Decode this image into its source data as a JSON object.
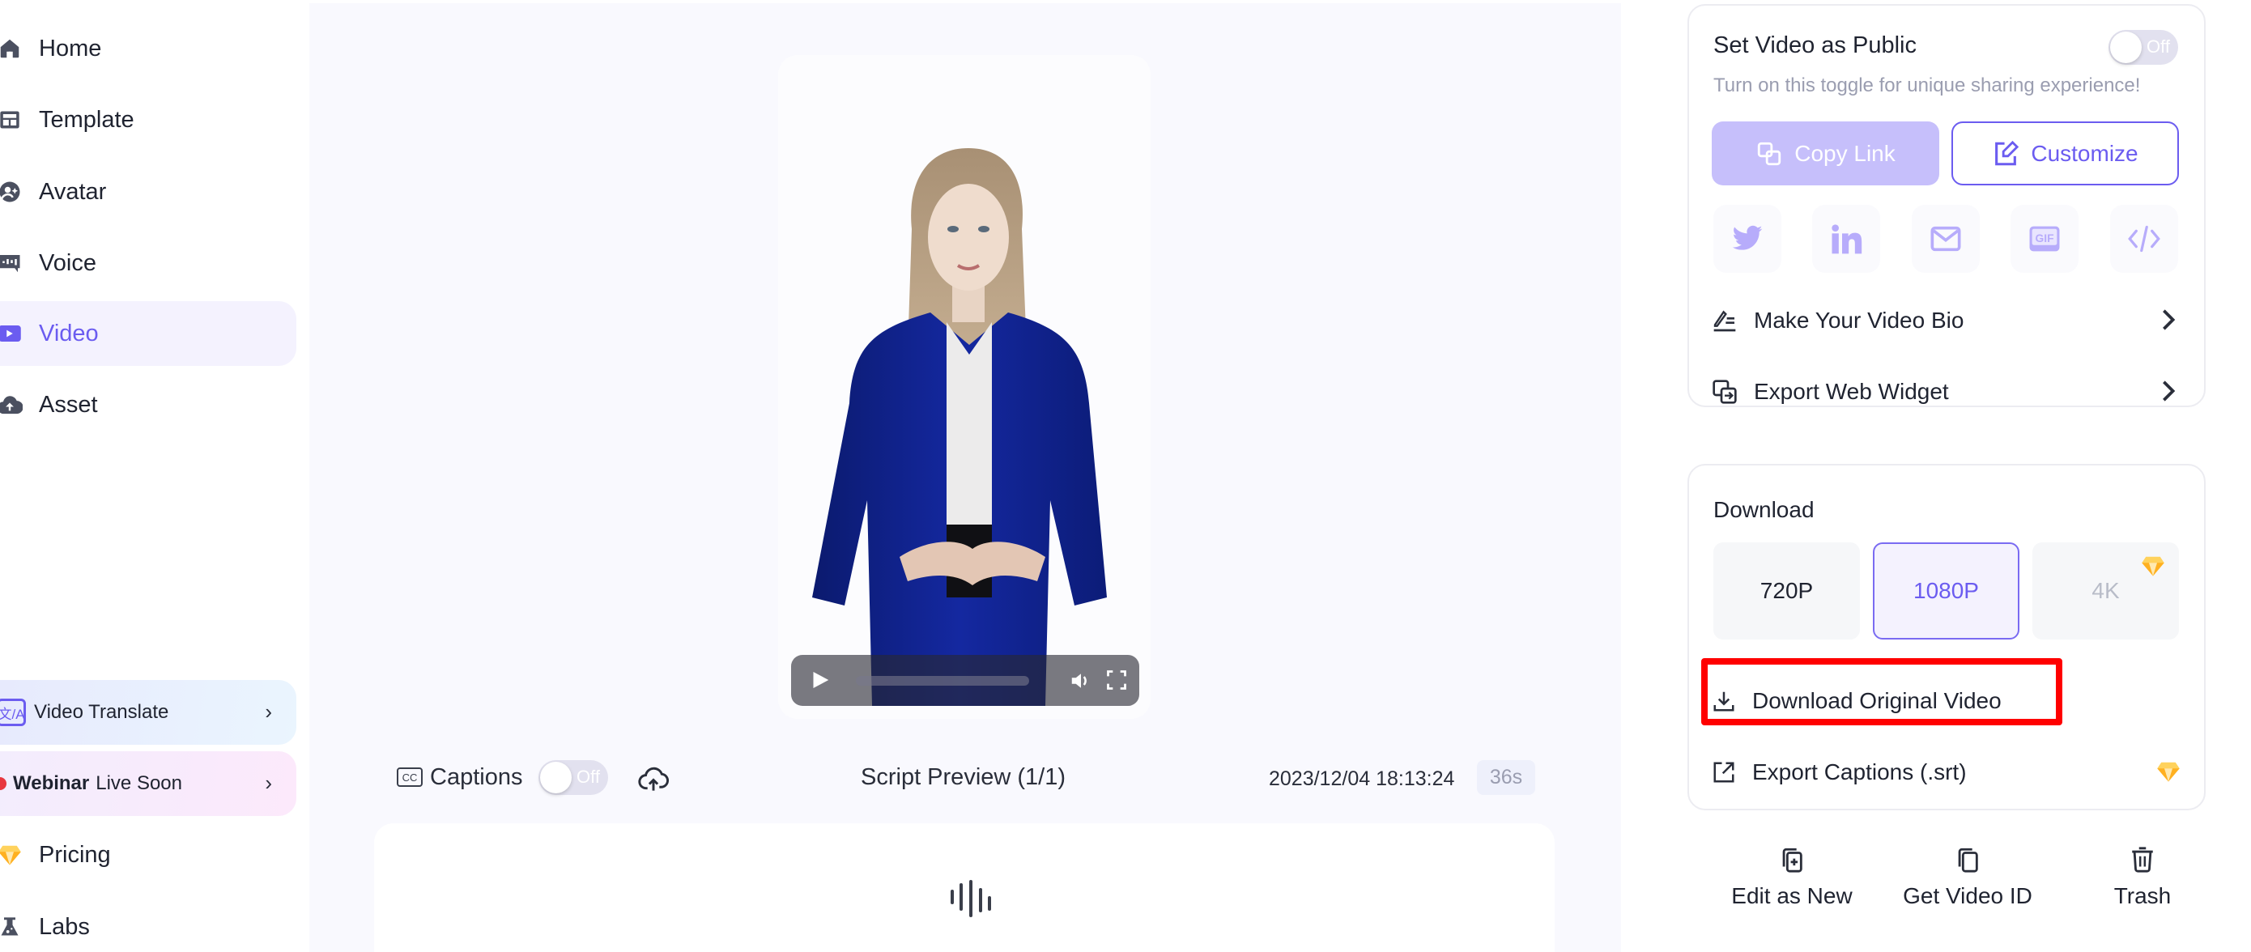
{
  "sidebar": {
    "items": [
      {
        "label": "Home",
        "icon": "home-icon"
      },
      {
        "label": "Template",
        "icon": "template-icon"
      },
      {
        "label": "Avatar",
        "icon": "avatar-icon"
      },
      {
        "label": "Voice",
        "icon": "voice-icon"
      },
      {
        "label": "Video",
        "icon": "video-icon",
        "active": true
      },
      {
        "label": "Asset",
        "icon": "cloud-upload-icon"
      }
    ],
    "promos": {
      "translate": {
        "icon_text": "文/A",
        "label": "Video Translate"
      },
      "webinar": {
        "bold": "Webinar",
        "label": "Live Soon"
      }
    },
    "bottom": [
      {
        "label": "Pricing",
        "icon": "diamond-icon"
      },
      {
        "label": "Labs",
        "icon": "flask-icon"
      }
    ]
  },
  "main": {
    "player": {
      "progress": 0
    },
    "captions": {
      "label": "Captions",
      "toggle": "Off"
    },
    "script_preview": "Script Preview (1/1)",
    "timestamp": "2023/12/04 18:13:24",
    "duration": "36s"
  },
  "share": {
    "title": "Set Video as Public",
    "toggle": "Off",
    "subtitle": "Turn on this toggle for unique sharing experience!",
    "copy_link": "Copy Link",
    "customize": "Customize",
    "icons": [
      "twitter-icon",
      "linkedin-icon",
      "mail-icon",
      "gif-icon",
      "code-icon"
    ],
    "gif_text": "GIF",
    "links": [
      "Make Your Video Bio",
      "Export Web Widget"
    ]
  },
  "download": {
    "title": "Download",
    "resolutions": [
      {
        "label": "720P",
        "state": "default"
      },
      {
        "label": "1080P",
        "state": "selected"
      },
      {
        "label": "4K",
        "state": "premium"
      }
    ],
    "original": "Download Original Video",
    "captions": "Export Captions (.srt)"
  },
  "actions": [
    "Edit as New",
    "Get Video ID",
    "Trash"
  ],
  "colors": {
    "accent": "#6b5cf0",
    "highlight": "#ff0000",
    "premium": "#ffb020"
  }
}
